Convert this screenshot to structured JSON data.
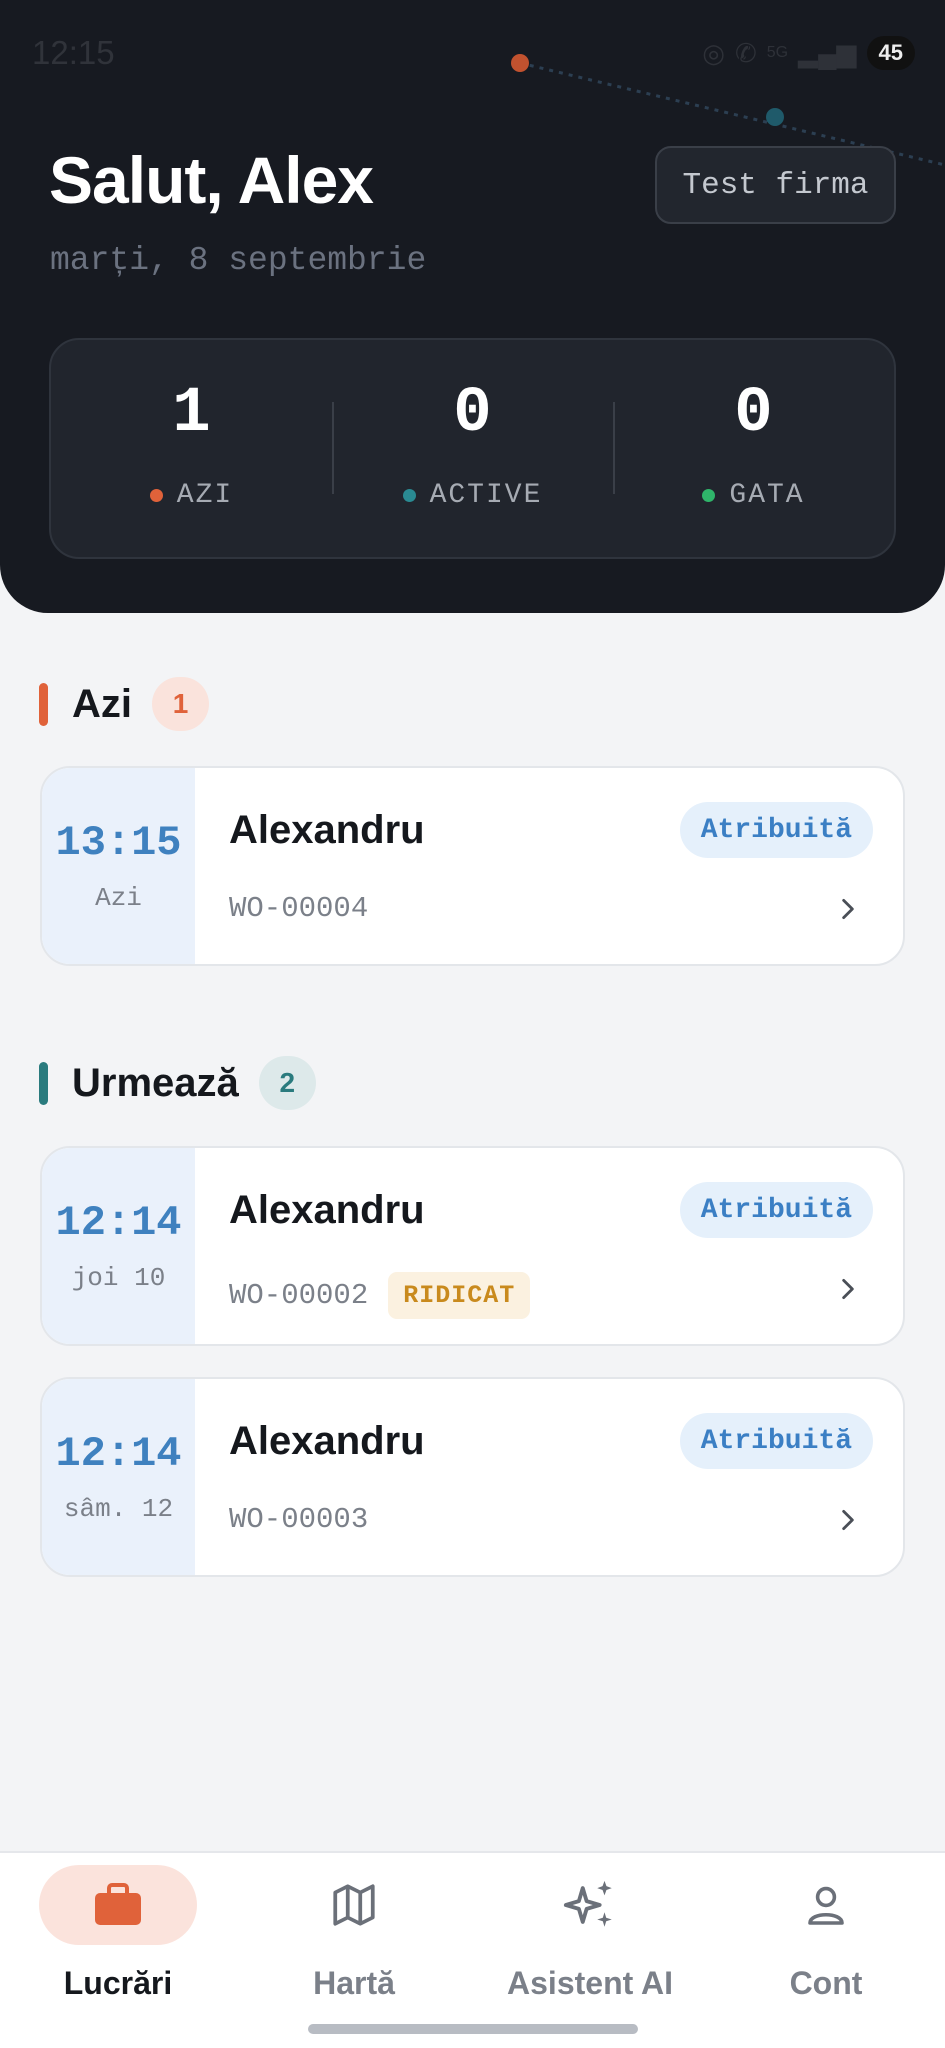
{
  "status_bar": {
    "time": "12:15",
    "battery": "45",
    "network": "5G"
  },
  "header": {
    "greeting": "Salut, Alex",
    "date": "marți, 8 septembrie",
    "company": "Test firma"
  },
  "stats": [
    {
      "value": "1",
      "label": "AZI",
      "color": "#e0623a"
    },
    {
      "value": "0",
      "label": "ACTIVE",
      "color": "#2a8a92"
    },
    {
      "value": "0",
      "label": "GATA",
      "color": "#2fb56a"
    }
  ],
  "sections": {
    "today": {
      "title": "Azi",
      "count": "1",
      "accent": "#e0623a"
    },
    "upcoming": {
      "title": "Urmează",
      "count": "2",
      "accent": "#2a7b7e"
    }
  },
  "jobs": [
    {
      "time": "13:15",
      "day": "Azi",
      "client": "Alexandru",
      "wo": "WO-00004",
      "status": "Atribuită",
      "tag": ""
    },
    {
      "time": "12:14",
      "day": "joi 10",
      "client": "Alexandru",
      "wo": "WO-00002",
      "status": "Atribuită",
      "tag": "RIDICAT"
    },
    {
      "time": "12:14",
      "day": "sâm. 12",
      "client": "Alexandru",
      "wo": "WO-00003",
      "status": "Atribuită",
      "tag": ""
    }
  ],
  "nav": [
    {
      "label": "Lucrări",
      "icon": "briefcase-icon",
      "active": true
    },
    {
      "label": "Hartă",
      "icon": "map-icon",
      "active": false
    },
    {
      "label": "Asistent AI",
      "icon": "sparkles-icon",
      "active": false
    },
    {
      "label": "Cont",
      "icon": "user-icon",
      "active": false
    }
  ],
  "colors": {
    "accent": "#e0623a",
    "header_bg": "#171a21",
    "link": "#3b7fc4"
  }
}
